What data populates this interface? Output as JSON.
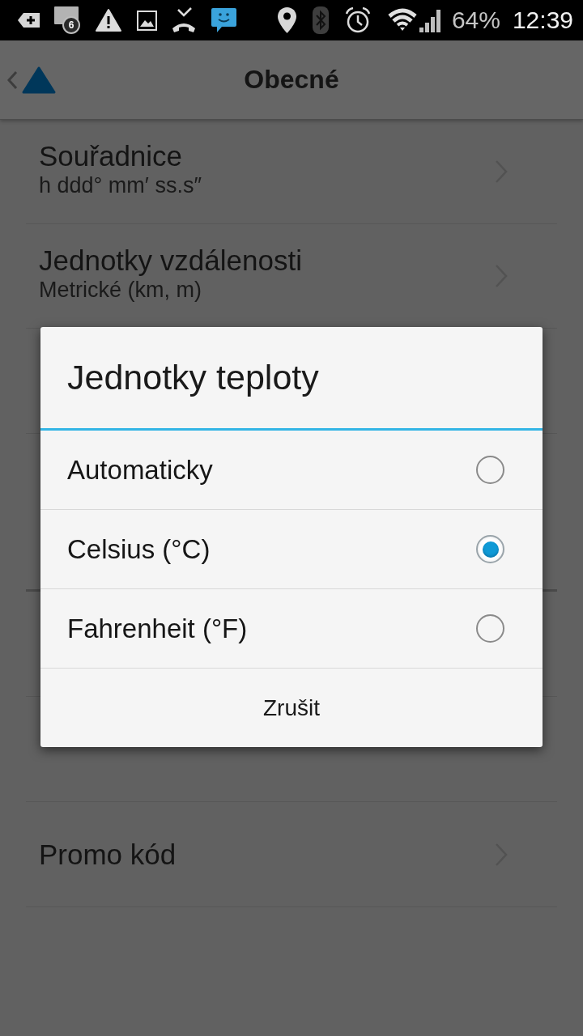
{
  "status_bar": {
    "notification_count": "6",
    "battery": "64%",
    "time": "12:39"
  },
  "app_bar": {
    "title": "Obecné"
  },
  "settings": [
    {
      "title": "Souřadnice",
      "subtitle": "h ddd° mm′ ss.s″"
    },
    {
      "title": "Jednotky vzdálenosti",
      "subtitle": "Metrické (km, m)"
    }
  ],
  "settings_lower": [
    {
      "title": "Promo kód"
    }
  ],
  "dialog": {
    "title": "Jednotky teploty",
    "options": [
      {
        "label": "Automaticky",
        "selected": false
      },
      {
        "label": "Celsius (°C)",
        "selected": true
      },
      {
        "label": "Fahrenheit (°F)",
        "selected": false
      }
    ],
    "cancel": "Zrušit"
  }
}
